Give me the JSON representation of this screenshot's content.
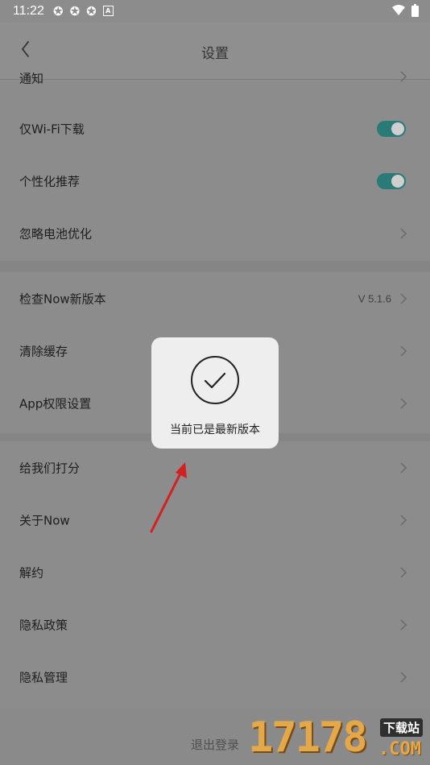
{
  "status": {
    "time": "11:22",
    "icons": [
      "sync-icon",
      "sync-icon",
      "sync-icon",
      "a-icon"
    ],
    "right_icons": [
      "wifi-icon",
      "battery-icon"
    ]
  },
  "header": {
    "title": "设置"
  },
  "rows_top": [
    {
      "label": "通知",
      "control": "chevron"
    },
    {
      "label": "仅Wi-Fi下载",
      "control": "toggle",
      "state": "on"
    },
    {
      "label": "个性化推荐",
      "control": "toggle",
      "state": "on"
    },
    {
      "label": "忽略电池优化",
      "control": "chevron"
    }
  ],
  "rows_mid": [
    {
      "label": "检查Now新版本",
      "value": "V 5.1.6",
      "control": "chevron"
    },
    {
      "label": "清除缓存",
      "control": "chevron"
    },
    {
      "label": "App权限设置",
      "control": "chevron"
    }
  ],
  "rows_bottom": [
    {
      "label": "给我们打分",
      "control": "chevron"
    },
    {
      "label": "关于Now",
      "control": "chevron"
    },
    {
      "label": "解约",
      "control": "chevron"
    },
    {
      "label": "隐私政策",
      "control": "chevron"
    },
    {
      "label": "隐私管理",
      "control": "chevron"
    }
  ],
  "toast": {
    "message": "当前已是最新版本",
    "icon": "check-circle-icon"
  },
  "logout": {
    "label": "退出登录"
  },
  "watermark": {
    "number": "17178",
    "tag": "下载站",
    "domain": ".COM"
  },
  "colors": {
    "toggle_on": "#2a7b78",
    "arrow": "#d42020",
    "overlay": "#8c8c8c",
    "toast_bg": "#eeeeee"
  }
}
